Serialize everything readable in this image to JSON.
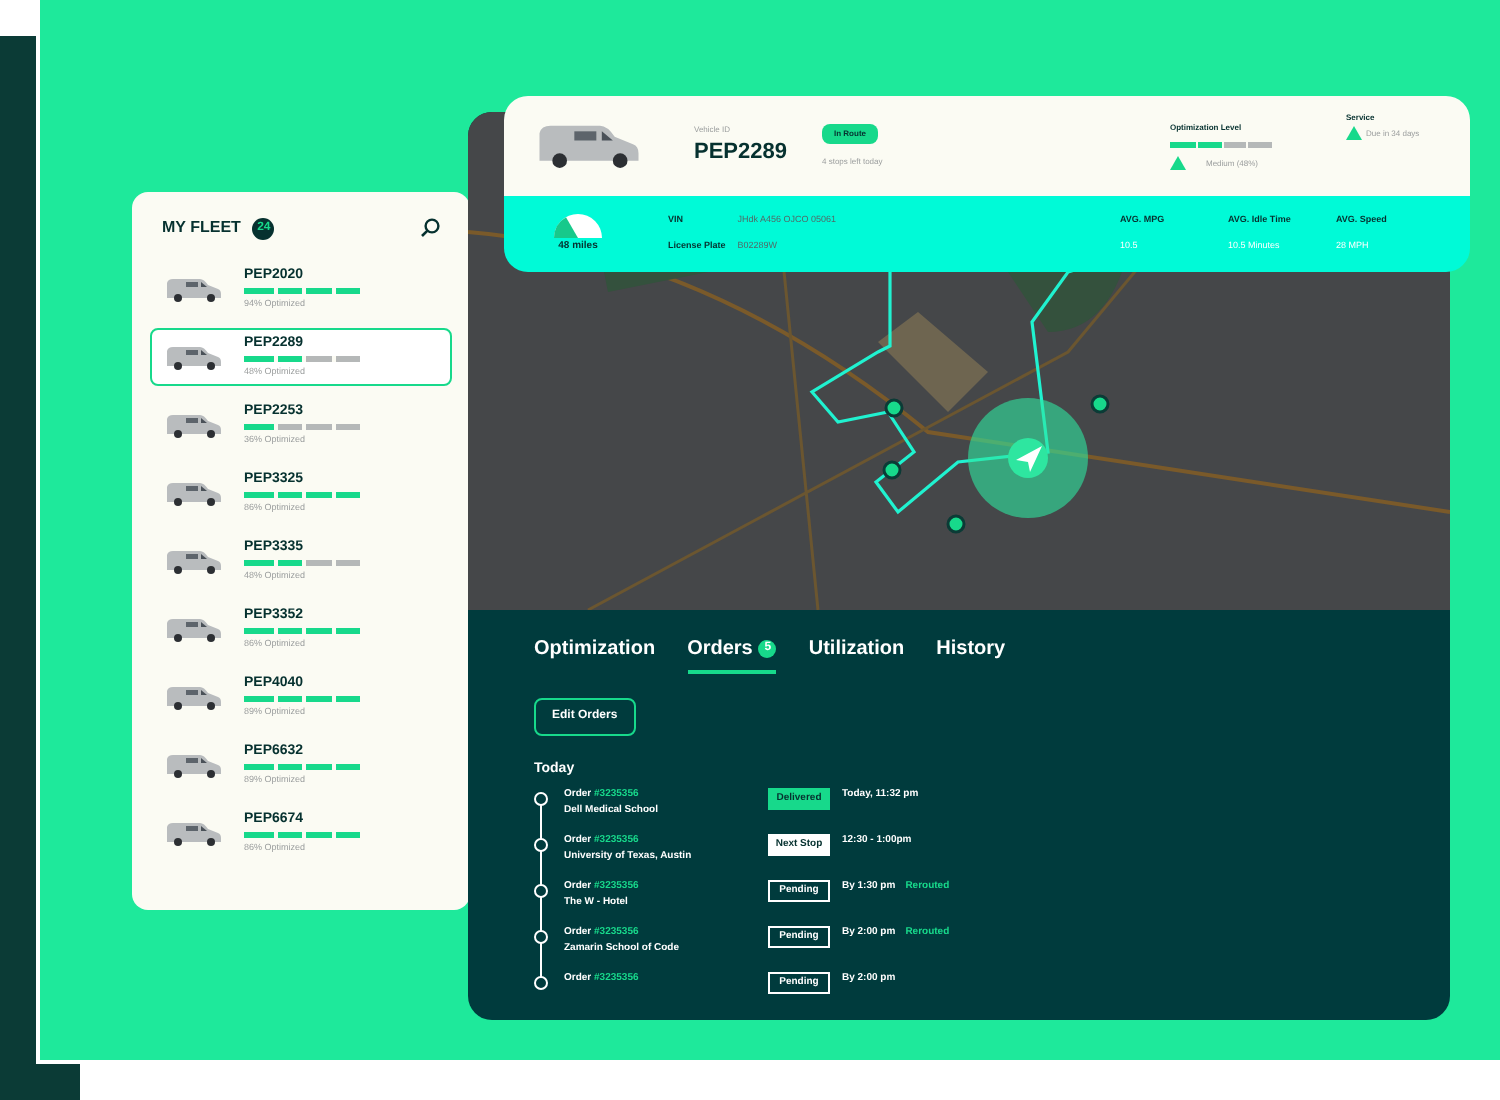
{
  "fleet": {
    "title": "MY FLEET",
    "count": "24",
    "vehicles": [
      {
        "name": "PEP2020",
        "level": 1,
        "caption": "94% Optimized",
        "selected": false
      },
      {
        "name": "PEP2289",
        "level": 0.5,
        "caption": "48% Optimized",
        "selected": true
      },
      {
        "name": "PEP2253",
        "level": 0.25,
        "caption": "36% Optimized",
        "selected": false
      },
      {
        "name": "PEP3325",
        "level": 1,
        "caption": "86% Optimized",
        "selected": false
      },
      {
        "name": "PEP3335",
        "level": 0.5,
        "caption": "48% Optimized",
        "selected": false
      },
      {
        "name": "PEP3352",
        "level": 1,
        "caption": "86% Optimized",
        "selected": false
      },
      {
        "name": "PEP4040",
        "level": 1,
        "caption": "89% Optimized",
        "selected": false
      },
      {
        "name": "PEP6632",
        "level": 1,
        "caption": "89% Optimized",
        "selected": false
      },
      {
        "name": "PEP6674",
        "level": 1,
        "caption": "86% Optimized",
        "selected": false
      }
    ]
  },
  "vehicle": {
    "id_label": "Vehicle ID",
    "id": "PEP2289",
    "status": "In Route",
    "stops": "4 stops left today",
    "optimization_label": "Optimization Level",
    "optimization": {
      "level": 0.5
    },
    "optimization_text": "Medium (48%)",
    "service_label": "Service",
    "service_text": "Due in 34 days"
  },
  "info_bar": {
    "distance": "48 miles",
    "vin_label": "VIN",
    "vin": "JHdk A456 OJCO 05061",
    "plate_label": "License Plate",
    "plate": "B02289W",
    "stats": [
      {
        "label": "AVG. MPG",
        "value": "10.5"
      },
      {
        "label": "AVG. Idle Time",
        "value": "10.5 Minutes"
      },
      {
        "label": "AVG. Speed",
        "value": "28 MPH"
      }
    ]
  },
  "tabs": [
    {
      "label": "Optimization",
      "selected": false
    },
    {
      "label": "Orders",
      "badge": "5",
      "selected": true
    },
    {
      "label": "Utilization",
      "selected": false
    },
    {
      "label": "History",
      "selected": false
    }
  ],
  "edit_button": "Edit Orders",
  "day": "Today",
  "orders": [
    {
      "label": "Order",
      "number": "#3235356",
      "place": "Dell Medical School",
      "status": "Delivered",
      "kind": "delivered",
      "time": "Today, 11:32 pm"
    },
    {
      "label": "Order",
      "number": "#3235356",
      "place": "University of Texas, Austin",
      "status": "Next Stop",
      "kind": "next",
      "time": "12:30 - 1:00pm"
    },
    {
      "label": "Order",
      "number": "#3235356",
      "place": "The W - Hotel",
      "status": "Pending",
      "kind": "pending",
      "time": "By 1:30 pm",
      "note": "Rerouted"
    },
    {
      "label": "Order",
      "number": "#3235356",
      "place": "Zamarin School of Code",
      "status": "Pending",
      "kind": "pending",
      "time": "By 2:00 pm",
      "note": "Rerouted"
    },
    {
      "label": "Order",
      "number": "#3235356",
      "status": "Pending",
      "kind": "pending",
      "time": "By 2:00 pm"
    }
  ]
}
